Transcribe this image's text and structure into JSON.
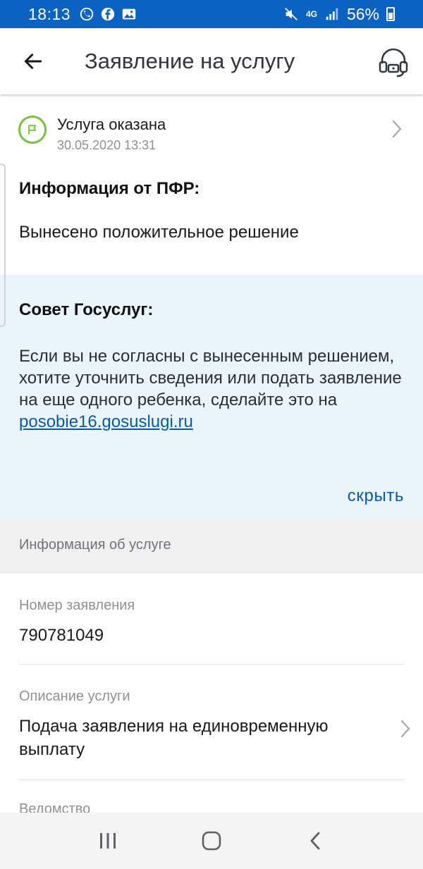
{
  "statusbar": {
    "time": "18:13",
    "battery": "56%",
    "network": "4G"
  },
  "appbar": {
    "title": "Заявление на услугу"
  },
  "status": {
    "title": "Услуга оказана",
    "date": "30.05.2020 13:31"
  },
  "pfr": {
    "heading": "Информация от ПФР:",
    "text": "Вынесено положительное решение"
  },
  "advice": {
    "heading": "Совет Госуслуг:",
    "text": "Если вы не согласны с вынесенным решением, хотите уточнить сведения или подать заявление на еще одного ребенка, сделайте это на",
    "link": "posobie16.gosuslugi.ru",
    "hide_label": "скрыть"
  },
  "service_info": {
    "heading": "Информация об услуге",
    "fields": [
      {
        "label": "Номер заявления",
        "value": "790781049"
      },
      {
        "label": "Описание услуги",
        "value": "Подача заявления на единовременную выплату"
      },
      {
        "label": "Ведомство",
        "value": ""
      }
    ]
  },
  "colors": {
    "statusbar": "#0a63c2",
    "accent_green": "#7ac143",
    "link": "#0b5aa8",
    "advice_bg": "#e9f4fb"
  }
}
